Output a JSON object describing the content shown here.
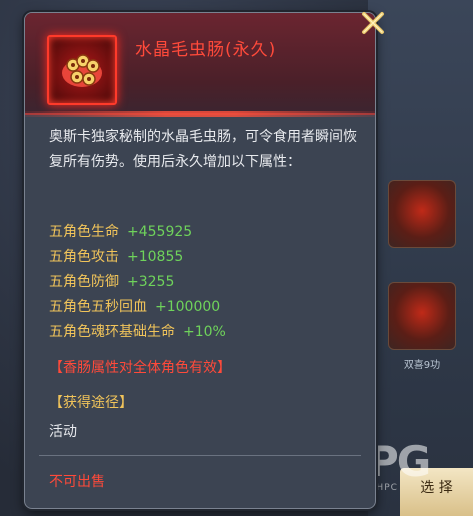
{
  "item": {
    "name": "水晶毛虫肠(永久)",
    "description": "奥斯卡独家秘制的水晶毛虫肠，可令食用者瞬间恢复所有伤势。使用后永久增加以下属性：",
    "attributes": [
      {
        "name": "五角色生命",
        "value": "+455925"
      },
      {
        "name": "五角色攻击",
        "value": "+10855"
      },
      {
        "name": "五角色防御",
        "value": "+3255"
      },
      {
        "name": "五角色五秒回血",
        "value": "+100000"
      },
      {
        "name": "五角色魂环基础生命",
        "value": "+10%"
      }
    ],
    "effect_note": "【香肠属性对全体角色有效】",
    "obtain_title": "【获得途径】",
    "obtain_value": "活动",
    "sell_status": "不可出售"
  },
  "background": {
    "item_label": "双喜9功",
    "select_button": "选 择"
  },
  "watermark": {
    "main": "PG",
    "sub": "PHPC"
  },
  "icons": {
    "close": "close-x-icon",
    "item": "crystal-caterpillar-sausage-icon"
  },
  "colors": {
    "name_red": "#ff4a3a",
    "attr_gold": "#f1c45a",
    "value_green": "#6fd35b"
  }
}
